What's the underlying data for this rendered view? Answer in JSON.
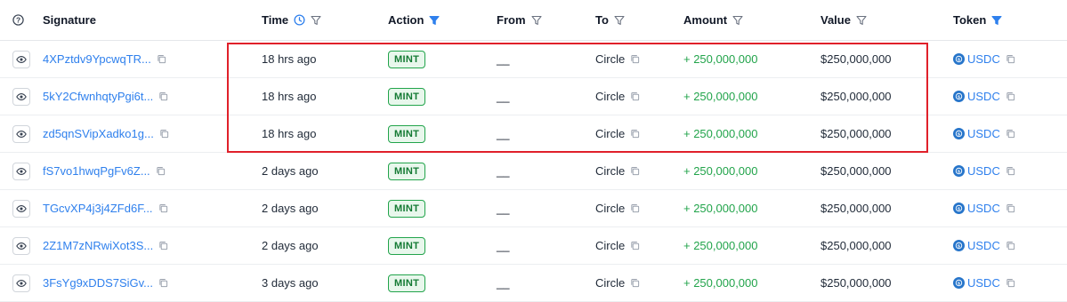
{
  "header": {
    "signature": "Signature",
    "time": "Time",
    "action": "Action",
    "from": "From",
    "to": "To",
    "amount": "Amount",
    "value": "Value",
    "token": "Token"
  },
  "rows": [
    {
      "signature": "4XPztdv9YpcwqTR...",
      "time": "18 hrs ago",
      "action": "MINT",
      "from": "__",
      "to": "Circle",
      "amount": "+ 250,000,000",
      "value": "$250,000,000",
      "token": "USDC"
    },
    {
      "signature": "5kY2CfwnhqtyPgi6t...",
      "time": "18 hrs ago",
      "action": "MINT",
      "from": "__",
      "to": "Circle",
      "amount": "+ 250,000,000",
      "value": "$250,000,000",
      "token": "USDC"
    },
    {
      "signature": "zd5qnSVipXadko1g...",
      "time": "18 hrs ago",
      "action": "MINT",
      "from": "__",
      "to": "Circle",
      "amount": "+ 250,000,000",
      "value": "$250,000,000",
      "token": "USDC"
    },
    {
      "signature": "fS7vo1hwqPgFv6Z...",
      "time": "2 days ago",
      "action": "MINT",
      "from": "__",
      "to": "Circle",
      "amount": "+ 250,000,000",
      "value": "$250,000,000",
      "token": "USDC"
    },
    {
      "signature": "TGcvXP4j3j4ZFd6F...",
      "time": "2 days ago",
      "action": "MINT",
      "from": "__",
      "to": "Circle",
      "amount": "+ 250,000,000",
      "value": "$250,000,000",
      "token": "USDC"
    },
    {
      "signature": "2Z1M7zNRwiXot3S...",
      "time": "2 days ago",
      "action": "MINT",
      "from": "__",
      "to": "Circle",
      "amount": "+ 250,000,000",
      "value": "$250,000,000",
      "token": "USDC"
    },
    {
      "signature": "3FsYg9xDDS7SiGv...",
      "time": "3 days ago",
      "action": "MINT",
      "from": "__",
      "to": "Circle",
      "amount": "+ 250,000,000",
      "value": "$250,000,000",
      "token": "USDC"
    }
  ],
  "colors": {
    "link": "#2f80ed",
    "positive": "#22a44b",
    "highlight": "#e0202a",
    "filter_active": "#2f80ed"
  }
}
